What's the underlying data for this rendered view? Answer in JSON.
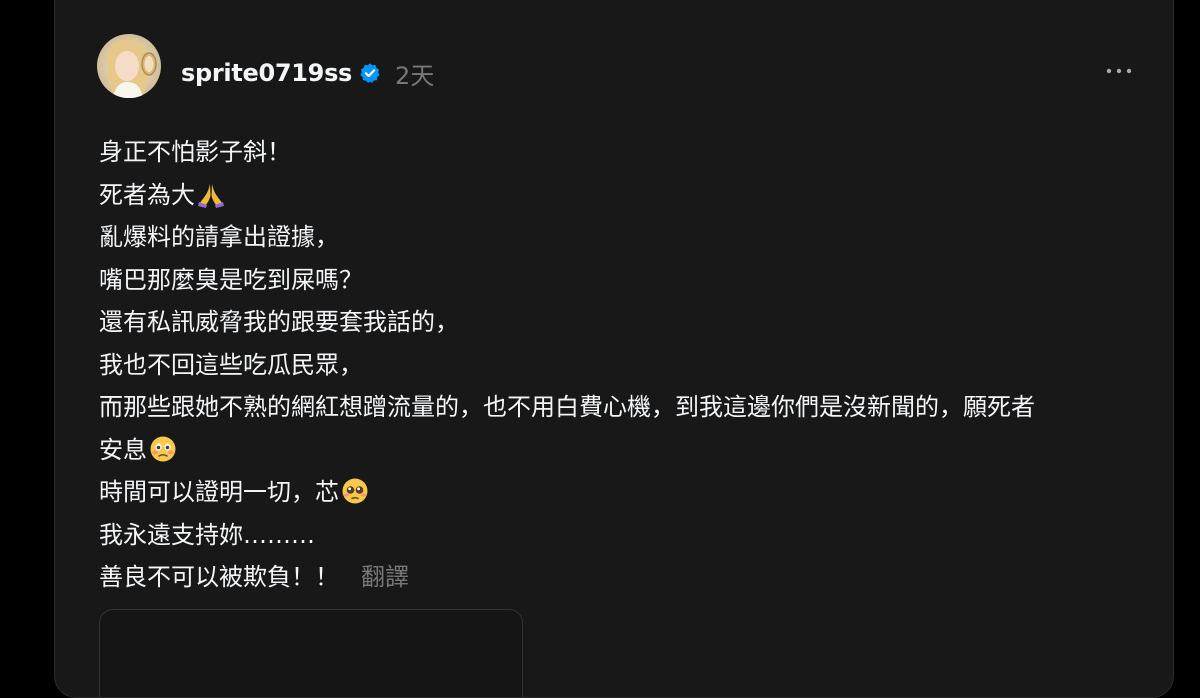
{
  "post": {
    "username": "sprite0719ss",
    "timestamp": "2天",
    "verified_color": "#0095f6",
    "lines": [
      "身正不怕影子斜！",
      "死者為大",
      "亂爆料的請拿出證據，",
      "嘴巴那麼臭是吃到屎嗎？",
      "還有私訊威脅我的跟要套我話的，",
      "我也不回這些吃瓜民眾，",
      "而那些跟她不熟的網紅想蹭流量的，也不用白費心機，到我這邊你們是沒新聞的，願死者",
      "安息",
      "時間可以證明一切，芯",
      "我永遠支持妳………",
      "善良不可以被欺負！！"
    ],
    "emojis": {
      "line2": "folded-hands-emoji",
      "line8": "flushed-sad-emoji",
      "line9": "pleading-face-emoji"
    },
    "translate_label": "翻譯"
  }
}
